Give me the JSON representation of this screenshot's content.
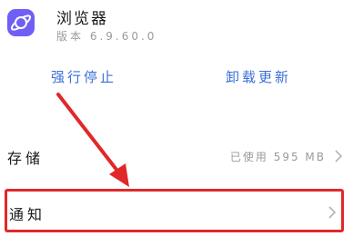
{
  "app": {
    "name": "浏览器",
    "version": "版本 6.9.60.0",
    "icon_color": "#6f5ff4",
    "icon": "planet-icon"
  },
  "actions": {
    "force_stop": "强行停止",
    "uninstall_update": "卸载更新",
    "accent_color": "#3b6fd6"
  },
  "settings": {
    "storage": {
      "label": "存储",
      "value": "已使用 595 MB"
    },
    "notification": {
      "label": "通知"
    }
  },
  "annotation": {
    "highlight_color": "#e0282a"
  }
}
